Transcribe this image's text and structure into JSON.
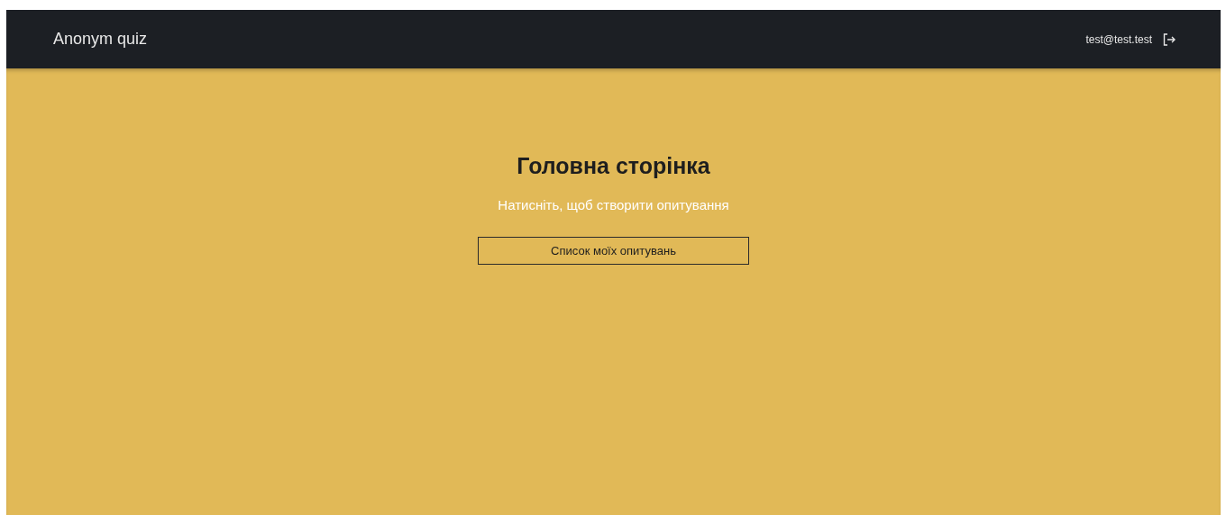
{
  "header": {
    "brand": "Anonym quiz",
    "user_email": "test@test.test"
  },
  "main": {
    "title": "Головна сторінка",
    "subtitle": "Натисніть, щоб створити опитування",
    "button": "Список моїх опитувань"
  }
}
